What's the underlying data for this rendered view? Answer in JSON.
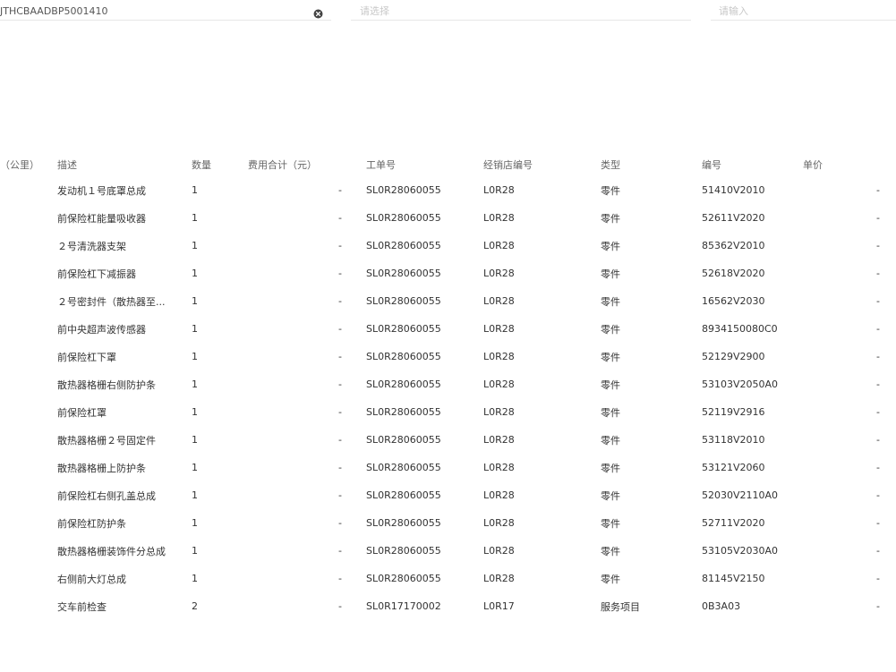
{
  "filters": {
    "vin_value": "JTHCBAADBP5001410",
    "select_placeholder": "请选择",
    "input_placeholder": "请输入"
  },
  "table": {
    "headers": {
      "mileage": "（公里）",
      "desc": "描述",
      "qty": "数量",
      "fee": "费用合计（元）",
      "order": "工单号",
      "dealer": "经销店编号",
      "type": "类型",
      "code": "编号",
      "price": "单价"
    },
    "rows": [
      {
        "desc": "发动机１号底罩总成",
        "qty": "1",
        "fee": "-",
        "order": "SL0R28060055",
        "dealer": "L0R28",
        "type": "零件",
        "code": "51410V2010",
        "price": "-"
      },
      {
        "desc": "前保险杠能量吸收器",
        "qty": "1",
        "fee": "-",
        "order": "SL0R28060055",
        "dealer": "L0R28",
        "type": "零件",
        "code": "52611V2020",
        "price": "-"
      },
      {
        "desc": "２号清洗器支架",
        "qty": "1",
        "fee": "-",
        "order": "SL0R28060055",
        "dealer": "L0R28",
        "type": "零件",
        "code": "85362V2010",
        "price": "-"
      },
      {
        "desc": "前保险杠下减振器",
        "qty": "1",
        "fee": "-",
        "order": "SL0R28060055",
        "dealer": "L0R28",
        "type": "零件",
        "code": "52618V2020",
        "price": "-"
      },
      {
        "desc": "２号密封件（散热器至...",
        "qty": "1",
        "fee": "-",
        "order": "SL0R28060055",
        "dealer": "L0R28",
        "type": "零件",
        "code": "16562V2030",
        "price": "-"
      },
      {
        "desc": "前中央超声波传感器",
        "qty": "1",
        "fee": "-",
        "order": "SL0R28060055",
        "dealer": "L0R28",
        "type": "零件",
        "code": "8934150080C0",
        "price": "-"
      },
      {
        "desc": "前保险杠下罩",
        "qty": "1",
        "fee": "-",
        "order": "SL0R28060055",
        "dealer": "L0R28",
        "type": "零件",
        "code": "52129V2900",
        "price": "-"
      },
      {
        "desc": "散热器格栅右侧防护条",
        "qty": "1",
        "fee": "-",
        "order": "SL0R28060055",
        "dealer": "L0R28",
        "type": "零件",
        "code": "53103V2050A0",
        "price": "-"
      },
      {
        "desc": "前保险杠罩",
        "qty": "1",
        "fee": "-",
        "order": "SL0R28060055",
        "dealer": "L0R28",
        "type": "零件",
        "code": "52119V2916",
        "price": "-"
      },
      {
        "desc": "散热器格栅２号固定件",
        "qty": "1",
        "fee": "-",
        "order": "SL0R28060055",
        "dealer": "L0R28",
        "type": "零件",
        "code": "53118V2010",
        "price": "-"
      },
      {
        "desc": "散热器格栅上防护条",
        "qty": "1",
        "fee": "-",
        "order": "SL0R28060055",
        "dealer": "L0R28",
        "type": "零件",
        "code": "53121V2060",
        "price": "-"
      },
      {
        "desc": "前保险杠右侧孔盖总成",
        "qty": "1",
        "fee": "-",
        "order": "SL0R28060055",
        "dealer": "L0R28",
        "type": "零件",
        "code": "52030V2110A0",
        "price": "-"
      },
      {
        "desc": "前保险杠防护条",
        "qty": "1",
        "fee": "-",
        "order": "SL0R28060055",
        "dealer": "L0R28",
        "type": "零件",
        "code": "52711V2020",
        "price": "-"
      },
      {
        "desc": "散热器格栅装饰件分总成",
        "qty": "1",
        "fee": "-",
        "order": "SL0R28060055",
        "dealer": "L0R28",
        "type": "零件",
        "code": "53105V2030A0",
        "price": "-"
      },
      {
        "desc": "右侧前大灯总成",
        "qty": "1",
        "fee": "-",
        "order": "SL0R28060055",
        "dealer": "L0R28",
        "type": "零件",
        "code": "81145V2150",
        "price": "-"
      },
      {
        "desc": "交车前检查",
        "qty": "2",
        "fee": "-",
        "order": "SL0R17170002",
        "dealer": "L0R17",
        "type": "服务项目",
        "code": "0B3A03",
        "price": "-"
      }
    ]
  }
}
